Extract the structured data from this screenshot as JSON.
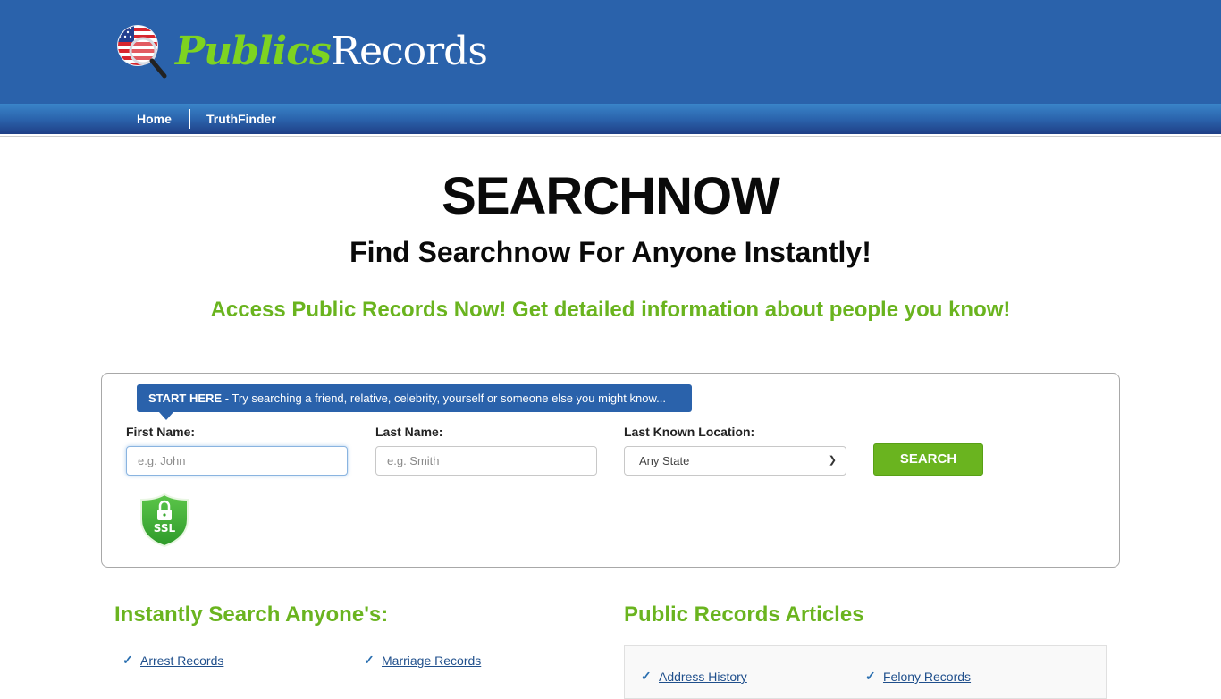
{
  "header": {
    "logo": {
      "part1": "Publics",
      "part2": "Records",
      "icon": "flag-magnifier-icon"
    },
    "colors": {
      "header_bg": "#2a62ab",
      "accent_green": "#6ab41f",
      "link_blue": "#1f4f8c"
    }
  },
  "nav": {
    "items": [
      {
        "label": "Home"
      },
      {
        "label": "TruthFinder"
      }
    ]
  },
  "hero": {
    "title": "SEARCHNOW",
    "subtitle": "Find Searchnow For Anyone Instantly!",
    "tagline": "Access Public Records Now! Get detailed information about people you know!"
  },
  "search": {
    "banner_bold": "START HERE",
    "banner_text": " - Try searching a friend, relative, celebrity, yourself or someone else you might know...",
    "first_name": {
      "label": "First Name:",
      "placeholder": "e.g. John",
      "value": ""
    },
    "last_name": {
      "label": "Last Name:",
      "placeholder": "e.g. Smith",
      "value": ""
    },
    "location": {
      "label": "Last Known Location:",
      "selected": "Any State"
    },
    "button_label": "SEARCH",
    "ssl_label": "SSL"
  },
  "instant_search": {
    "title": "Instantly Search Anyone's:",
    "items": [
      {
        "label": "Arrest Records"
      },
      {
        "label": "Marriage Records"
      }
    ]
  },
  "articles": {
    "title": "Public Records Articles",
    "items": [
      {
        "label": "Address History"
      },
      {
        "label": "Felony Records"
      }
    ]
  }
}
